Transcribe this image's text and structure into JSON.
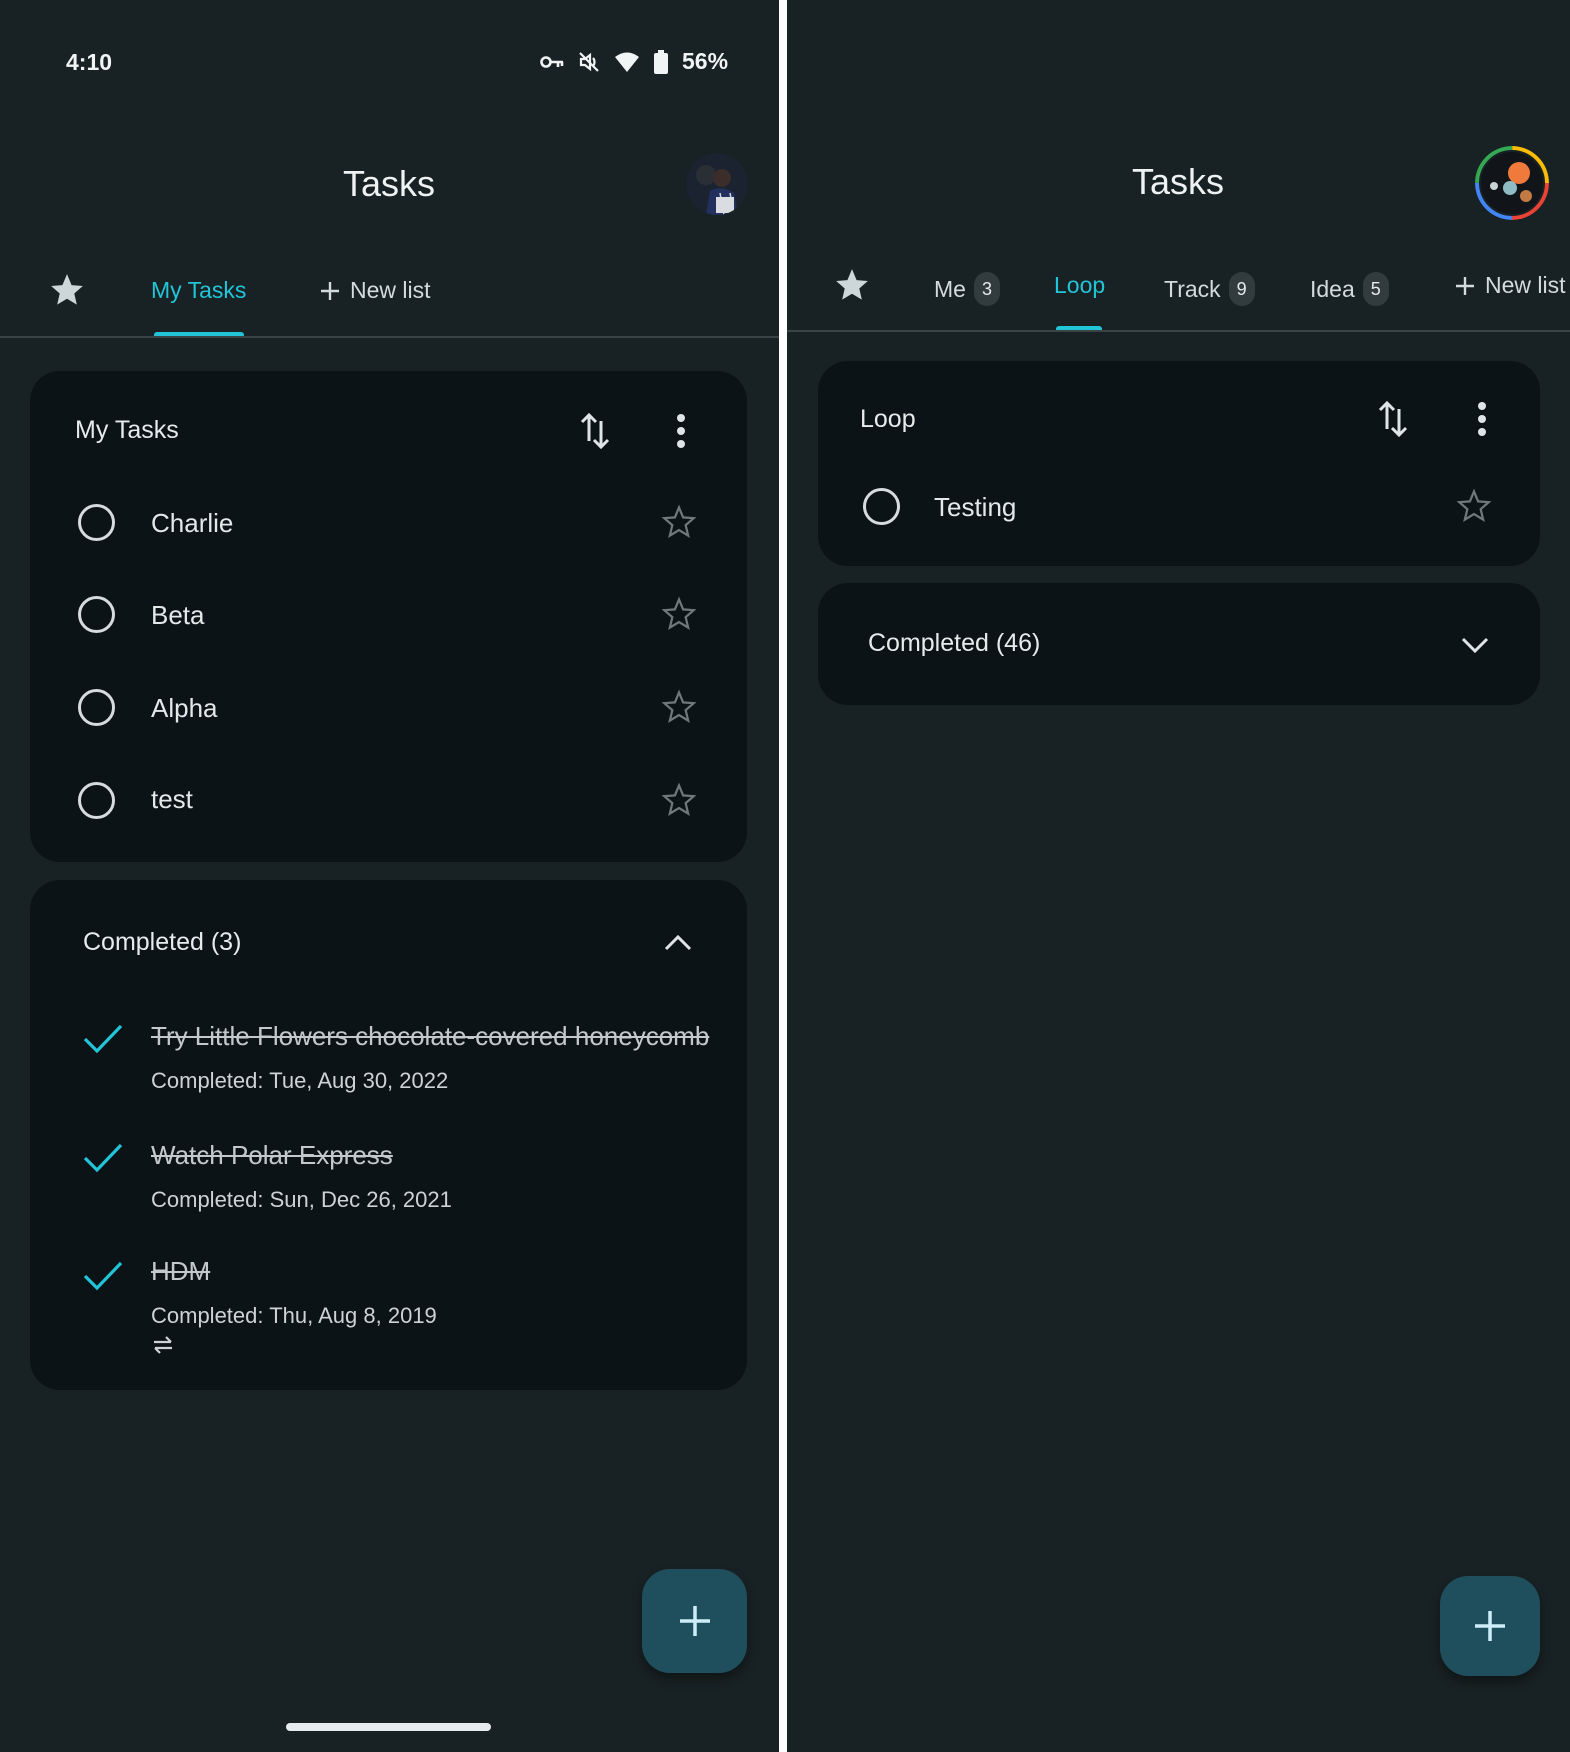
{
  "colors": {
    "background": "#182123",
    "card": "#0b1317",
    "accent": "#22c5d8",
    "fab": "#1f4f5d",
    "text": "#e3e8e9"
  },
  "left_screen": {
    "status_bar": {
      "time": "4:10",
      "icons": [
        "vpn-key-icon",
        "vibrate-off-icon",
        "wifi-icon",
        "battery-icon"
      ],
      "battery_percent": "56%"
    },
    "header": {
      "title": "Tasks",
      "avatar": "user-avatar-photo"
    },
    "tabs": {
      "starred_icon": "star-icon",
      "items": [
        {
          "label": "My Tasks",
          "active": true
        }
      ],
      "new_list_label": "New list"
    },
    "list_card": {
      "title": "My Tasks",
      "sort_icon": "sort-arrows-icon",
      "menu_icon": "more-vert-icon",
      "tasks": [
        {
          "title": "Charlie",
          "starred": false
        },
        {
          "title": "Beta",
          "starred": false
        },
        {
          "title": "Alpha",
          "starred": false
        },
        {
          "title": "test",
          "starred": false
        }
      ]
    },
    "completed_card": {
      "label": "Completed (3)",
      "expanded": true,
      "items": [
        {
          "title": "Try Little Flowers chocolate-covered honeycomb",
          "date": "Completed: Tue, Aug 30, 2022",
          "repeat": false
        },
        {
          "title": "Watch Polar Express",
          "date": "Completed: Sun, Dec 26, 2021",
          "repeat": false
        },
        {
          "title": "HDM",
          "date": "Completed: Thu, Aug 8, 2019",
          "repeat": true
        }
      ]
    },
    "fab_icon": "plus-icon"
  },
  "right_screen": {
    "header": {
      "title": "Tasks",
      "avatar": "planets-avatar"
    },
    "tabs": {
      "starred_icon": "star-icon",
      "items": [
        {
          "label": "Me",
          "badge": "3",
          "active": false
        },
        {
          "label": "Loop",
          "badge": null,
          "active": true
        },
        {
          "label": "Track",
          "badge": "9",
          "active": false
        },
        {
          "label": "Idea",
          "badge": "5",
          "active": false
        }
      ],
      "new_list_label": "New list"
    },
    "list_card": {
      "title": "Loop",
      "sort_icon": "sort-arrows-icon",
      "menu_icon": "more-vert-icon",
      "tasks": [
        {
          "title": "Testing",
          "starred": false
        }
      ]
    },
    "completed_card": {
      "label": "Completed (46)",
      "expanded": false
    },
    "fab_icon": "plus-icon"
  }
}
